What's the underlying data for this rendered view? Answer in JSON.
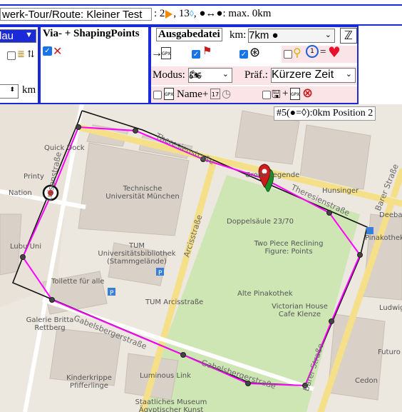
{
  "header": {
    "route_name": "werk-Tour/Route: Kleiner Test",
    "stats_prefix": ":",
    "flag_count": "2",
    "point_count": "13",
    "distance_text": "●↔●: max. 0km"
  },
  "left_panel": {
    "color_select": "lau",
    "unit_label": "km"
  },
  "via_panel": {
    "title": "Via- + ShapingPoints"
  },
  "output_panel": {
    "title": "Ausgabedatei",
    "km_label": "km:",
    "km_select": "7km ●",
    "modus_label": "Modus:",
    "praef_label": "Präf.:",
    "praef_select": "Kürzere Zeit",
    "name_label": "Name+",
    "gpx_text": "GPX",
    "arrow_text": "→"
  },
  "map": {
    "info_text": "#5(●=◊):0km Position 2",
    "labels": {
      "quick_dock": "Quick Dock",
      "printy": "Printy",
      "nation": "Nation",
      "lubu": "Lubu Uni",
      "tum": "Technische Universität München",
      "tum2": "TUM Universitätsbibliothek (Stammgelände)",
      "toilette": "Toilette für alle",
      "tum_arcis": "TUM Arcisstraße",
      "galerie": "Galerie Britta Rettberg",
      "kinderkrippe": "Kinderkrippe Pfifferlinge",
      "luminous": "Luminous Link",
      "staatliches": "Staatliches Museum Ägyptischer Kunst",
      "doppelsaule": "Doppelsäule 23/70",
      "two_piece": "Two Piece Reclining Figure: Points",
      "alte": "Alte Pinakothek",
      "victorian": "Victorian House Cafe Klenze",
      "hunsinger": "Hunsinger",
      "grosslegende": "Große Legende",
      "deeba": "Deeba",
      "pinakothek": "Pinakothek",
      "ludwig": "Ludwig",
      "futuro": "Futuro",
      "cedon": "Cedon"
    },
    "streets": {
      "theresien1": "Theresienstraße",
      "theresien2": "Theresienstraße",
      "arcis": "Arcisstraße",
      "gabelsberger1": "Gabelsbergerstraße",
      "gabelsberger2": "Gabelsbergerstraße",
      "barer": "Barer Straße",
      "barer2": "Barer Straße",
      "luisen": "Luisenstraße"
    }
  },
  "colors": {
    "panel_border": "#1a2ad6",
    "route_pink": "#ff00ff",
    "route_black": "#111111",
    "marker_red": "#cc1c1c",
    "marker_green": "#1b8e2a"
  }
}
